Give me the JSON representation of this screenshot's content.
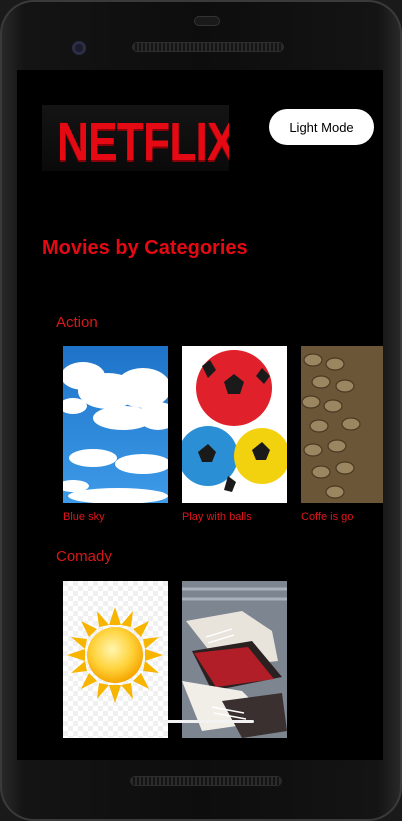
{
  "header": {
    "logo_text": "NETFLIX",
    "mode_button_label": "Light Mode"
  },
  "main": {
    "title": "Movies by Categories",
    "categories": [
      {
        "name": "Action",
        "items": [
          {
            "title": "Blue sky",
            "image": "blue-sky"
          },
          {
            "title": "Play with balls",
            "image": "colorful-balls"
          },
          {
            "title": "Coffe is go",
            "image": "coffee-beans"
          }
        ]
      },
      {
        "name": "Comady",
        "items": [
          {
            "title": "",
            "image": "sun"
          },
          {
            "title": "",
            "image": "sneakers"
          }
        ]
      }
    ]
  },
  "colors": {
    "accent": "#e50914",
    "background": "#000000",
    "button_bg": "#ffffff"
  }
}
